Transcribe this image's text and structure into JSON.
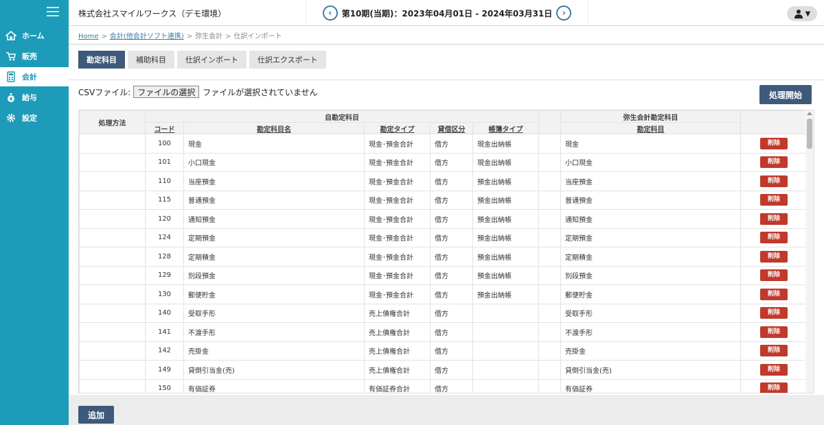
{
  "sidebar": {
    "items": [
      {
        "label": "ホーム",
        "icon": "home-icon"
      },
      {
        "label": "販売",
        "icon": "cart-icon"
      },
      {
        "label": "会計",
        "icon": "calculator-icon"
      },
      {
        "label": "給与",
        "icon": "money-bag-icon"
      },
      {
        "label": "設定",
        "icon": "gear-icon"
      }
    ],
    "active": "会計"
  },
  "header": {
    "company": "株式会社スマイルワークス（デモ環境）",
    "period": "第10期(当期)：2023年04月01日 - 2024年03月31日",
    "prev": "‹",
    "next": "›",
    "user_caret": "▼"
  },
  "breadcrumb": {
    "home": "Home",
    "accounting": "会計(他会計ソフト連携)",
    "yayoi": "弥生会計",
    "current": "仕訳インポート",
    "sep": ">"
  },
  "tabs": [
    "勘定科目",
    "補助科目",
    "仕訳インポート",
    "仕訳エクスポート"
  ],
  "csv": {
    "label": "CSVファイル:",
    "button": "ファイルの選択",
    "status": "ファイルが選択されていません"
  },
  "process_button": "処理開始",
  "table": {
    "headers": {
      "method": "処理方法",
      "own": "自勘定科目",
      "yayoi": "弥生会計勘定科目",
      "code": "コード",
      "name": "勘定科目名",
      "type": "勘定タイプ",
      "division": "貸借区分",
      "book_type": "帳簿タイプ",
      "yayoi_account": "勘定科目"
    },
    "delete_label": "削除",
    "rows": [
      {
        "code": "100",
        "name": "現金",
        "type": "現金･預金合計",
        "division": "借方",
        "book": "現金出納帳",
        "yayoi": "現金"
      },
      {
        "code": "101",
        "name": "小口現金",
        "type": "現金･預金合計",
        "division": "借方",
        "book": "現金出納帳",
        "yayoi": "小口現金"
      },
      {
        "code": "110",
        "name": "当座預金",
        "type": "現金･預金合計",
        "division": "借方",
        "book": "預金出納帳",
        "yayoi": "当座預金"
      },
      {
        "code": "115",
        "name": "普通預金",
        "type": "現金･預金合計",
        "division": "借方",
        "book": "預金出納帳",
        "yayoi": "普通預金"
      },
      {
        "code": "120",
        "name": "通知預金",
        "type": "現金･預金合計",
        "division": "借方",
        "book": "預金出納帳",
        "yayoi": "通知預金"
      },
      {
        "code": "124",
        "name": "定期預金",
        "type": "現金･預金合計",
        "division": "借方",
        "book": "預金出納帳",
        "yayoi": "定期預金"
      },
      {
        "code": "128",
        "name": "定期積金",
        "type": "現金･預金合計",
        "division": "借方",
        "book": "預金出納帳",
        "yayoi": "定期積金"
      },
      {
        "code": "129",
        "name": "別段預金",
        "type": "現金･預金合計",
        "division": "借方",
        "book": "預金出納帳",
        "yayoi": "別段預金"
      },
      {
        "code": "130",
        "name": "郵便貯金",
        "type": "現金･預金合計",
        "division": "借方",
        "book": "預金出納帳",
        "yayoi": "郵便貯金"
      },
      {
        "code": "140",
        "name": "受取手形",
        "type": "売上債権合計",
        "division": "借方",
        "book": "",
        "yayoi": "受取手形"
      },
      {
        "code": "141",
        "name": "不渡手形",
        "type": "売上債権合計",
        "division": "借方",
        "book": "",
        "yayoi": "不渡手形"
      },
      {
        "code": "142",
        "name": "売掛金",
        "type": "売上債権合計",
        "division": "借方",
        "book": "",
        "yayoi": "売掛金"
      },
      {
        "code": "149",
        "name": "貸倒引当金(売)",
        "type": "売上債権合計",
        "division": "借方",
        "book": "",
        "yayoi": "貸倒引当金(売)"
      },
      {
        "code": "150",
        "name": "有価証券",
        "type": "有価証券合計",
        "division": "借方",
        "book": "",
        "yayoi": "有価証券"
      }
    ]
  },
  "add_button": "追加",
  "colors": {
    "sidebar": "#1e9bb9",
    "primary": "#3e5a7a",
    "danger": "#c0392b"
  }
}
